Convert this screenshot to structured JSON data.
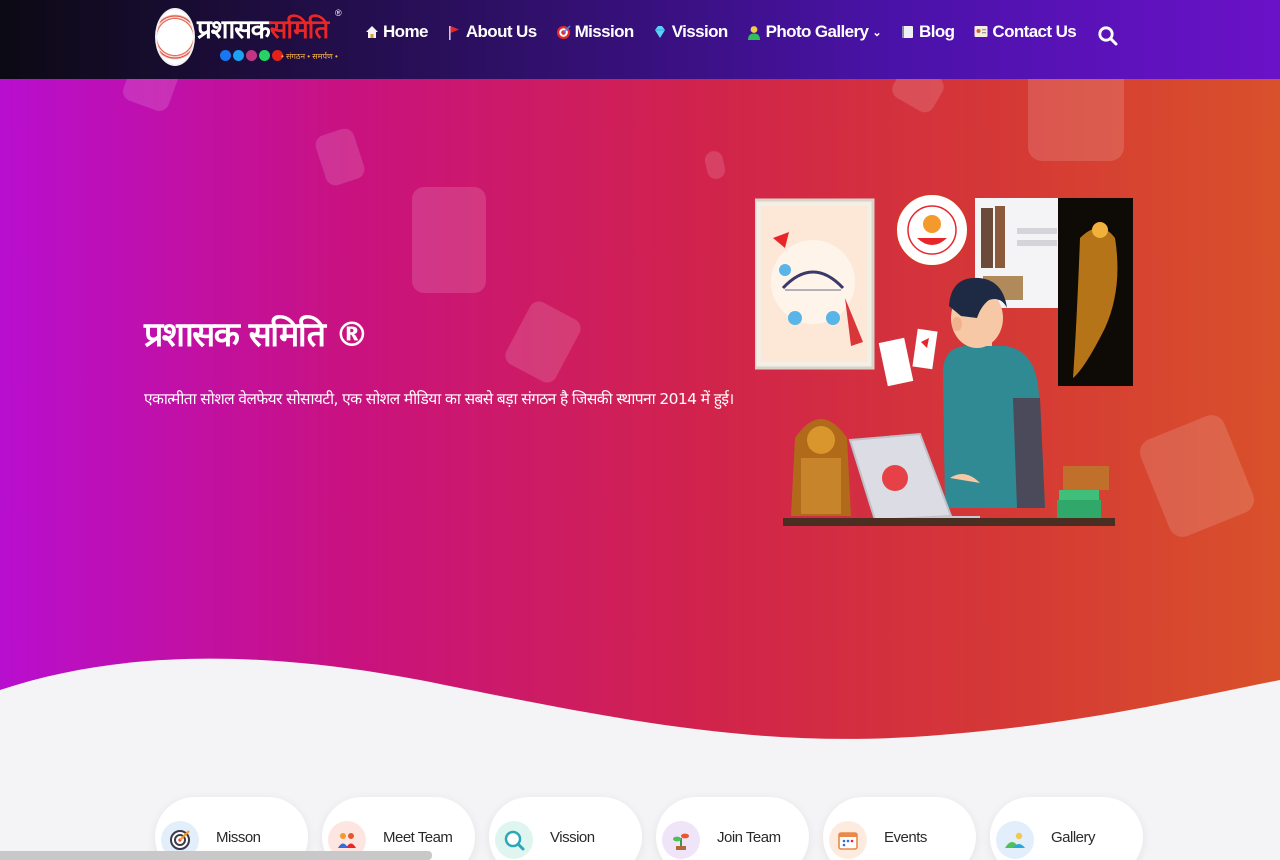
{
  "brand": {
    "name_part1": "प्रशासक",
    "name_part2": "समिति",
    "tagline": "• संगठन • समर्पण •",
    "reg_mark": "®",
    "social_colors": [
      "#1877f2",
      "#1da1f2",
      "#c13584",
      "#25d366",
      "#e62117"
    ]
  },
  "nav": {
    "items": [
      {
        "label": "Home",
        "icon": "home-icon"
      },
      {
        "label": "About Us",
        "icon": "flag-icon"
      },
      {
        "label": "Mission",
        "icon": "target-icon"
      },
      {
        "label": "Vission",
        "icon": "diamond-icon"
      },
      {
        "label": "Photo Gallery",
        "icon": "user-icon",
        "dropdown": true
      },
      {
        "label": "Blog",
        "icon": "book-icon"
      },
      {
        "label": "Contact Us",
        "icon": "contact-card-icon"
      }
    ],
    "search_icon": "search-icon"
  },
  "hero": {
    "title": "प्रशासक समिति ®",
    "subtitle": "एकात्मीता सोशल वेलफेयर सोसायटी, एक सोशल मीडिया का सबसे बड़ा संगठन है जिसकी स्थापना 2014 में हुई।"
  },
  "features": [
    {
      "label": "Misson",
      "icon": "target-icon",
      "bg": "#e3eefb"
    },
    {
      "label": "Meet Team",
      "icon": "team-icon",
      "bg": "#fde6e2"
    },
    {
      "label": "Vission",
      "icon": "magnifier-icon",
      "bg": "#def6ef"
    },
    {
      "label": "Join Team",
      "icon": "plant-icon",
      "bg": "#efe4f8"
    },
    {
      "label": "Events",
      "icon": "calendar-icon",
      "bg": "#fdebe0"
    },
    {
      "label": "Gallery",
      "icon": "image-icon",
      "bg": "#e3eefb"
    }
  ],
  "colors": {
    "header_start": "#0c0a14",
    "header_end": "#6a12c8",
    "hero_start": "#b80ecf",
    "hero_end": "#d9512b"
  }
}
